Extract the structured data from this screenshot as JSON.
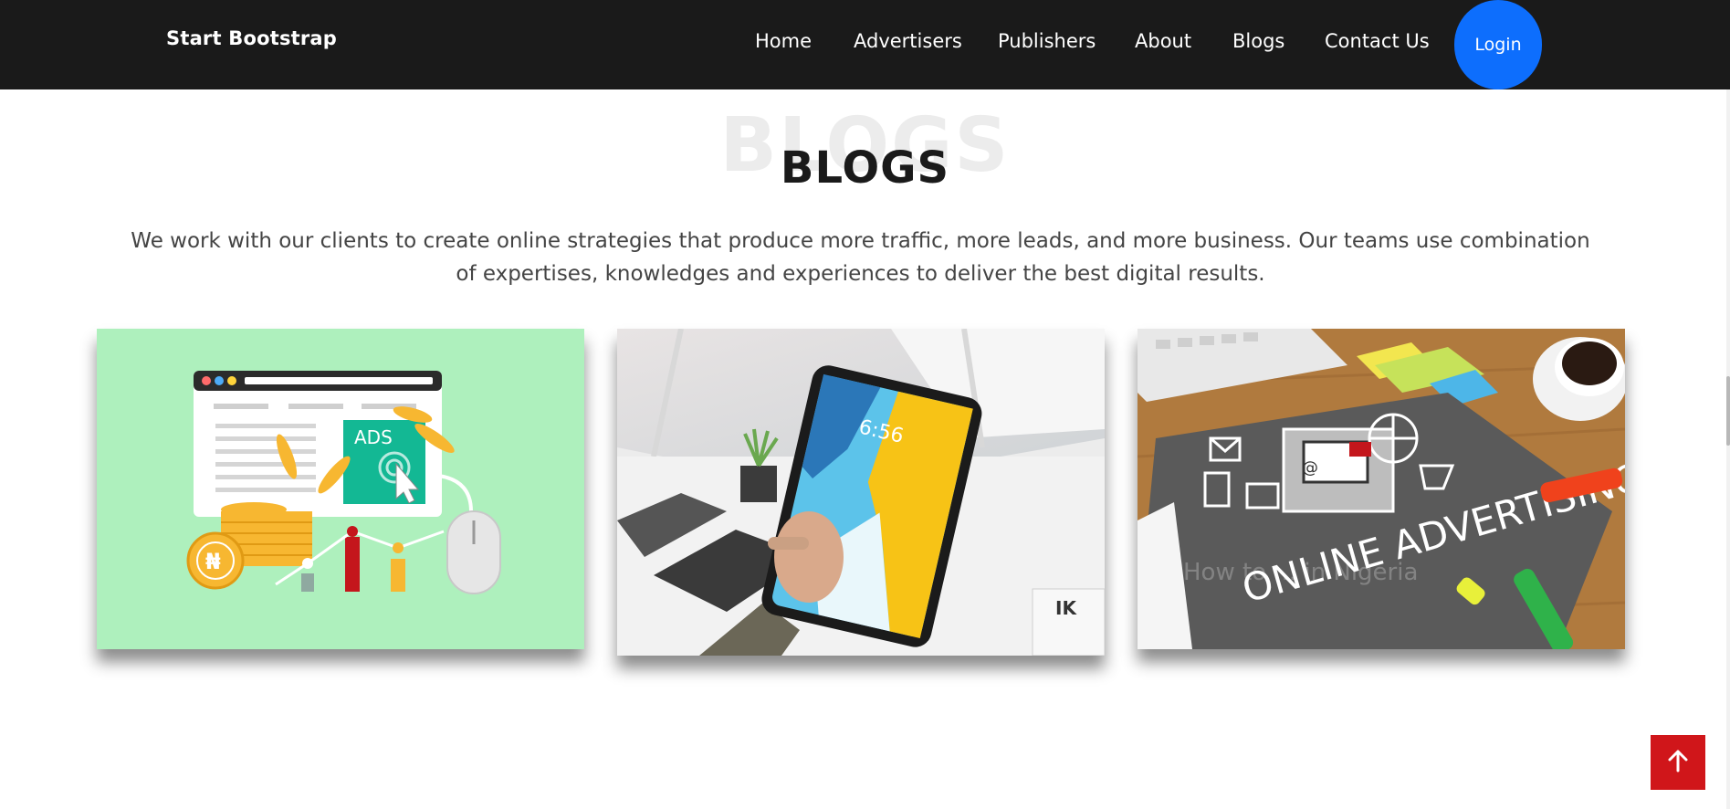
{
  "navbar": {
    "brand": "Start Bootstrap",
    "links": [
      "Home",
      "Advertisers",
      "Publishers",
      "About",
      "Blogs",
      "Contact Us"
    ],
    "login_label": "Login",
    "login_color": "#0d6efd",
    "background": "#1a1a1a"
  },
  "blogs": {
    "ghost_title": "BLOGS",
    "title": "BLOGS",
    "description": "We work with our clients to create online strategies that produce more traffic, more leads, and more business. Our teams use combination of expertises, knowledges and experiences to deliver the best digital results.",
    "cards": [
      {
        "image": "digital-ads-illustration",
        "image_text": "ADS"
      },
      {
        "image": "tablet-in-hand-photo",
        "image_text": "6:56"
      },
      {
        "image": "online-advertising-photo",
        "image_text": "ONLINE ADVERTISING",
        "overlay_text": "How to ... in Nigeria"
      }
    ]
  },
  "back_to_top": {
    "icon": "arrow-up-icon",
    "color": "#d0161a"
  }
}
